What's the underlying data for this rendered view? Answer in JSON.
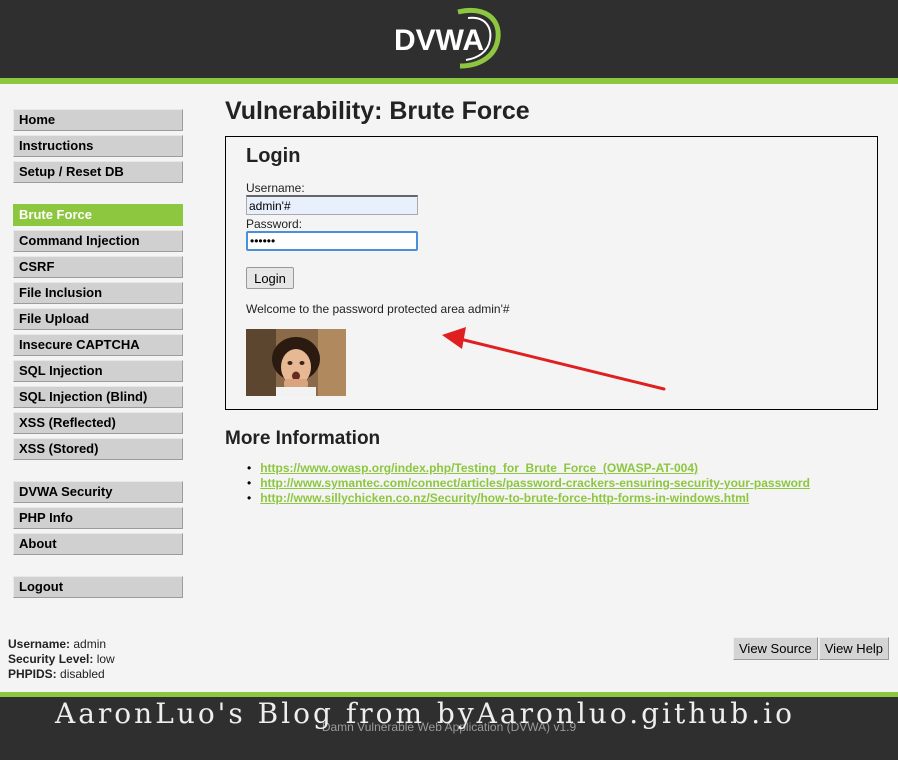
{
  "header": {
    "logo_text": "DVWA"
  },
  "sidebar": {
    "group1": [
      {
        "label": "Home"
      },
      {
        "label": "Instructions"
      },
      {
        "label": "Setup / Reset DB"
      }
    ],
    "group2": [
      {
        "label": "Brute Force",
        "active": true
      },
      {
        "label": "Command Injection"
      },
      {
        "label": "CSRF"
      },
      {
        "label": "File Inclusion"
      },
      {
        "label": "File Upload"
      },
      {
        "label": "Insecure CAPTCHA"
      },
      {
        "label": "SQL Injection"
      },
      {
        "label": "SQL Injection (Blind)"
      },
      {
        "label": "XSS (Reflected)"
      },
      {
        "label": "XSS (Stored)"
      }
    ],
    "group3": [
      {
        "label": "DVWA Security"
      },
      {
        "label": "PHP Info"
      },
      {
        "label": "About"
      }
    ],
    "group4": [
      {
        "label": "Logout"
      }
    ]
  },
  "main": {
    "title": "Vulnerability: Brute Force",
    "login": {
      "title": "Login",
      "username_label": "Username:",
      "username_value": "admin'#",
      "password_label": "Password:",
      "password_value": "••••••",
      "button_label": "Login",
      "welcome": "Welcome to the password protected area admin'#"
    },
    "more_info": {
      "title": "More Information",
      "links": [
        "https://www.owasp.org/index.php/Testing_for_Brute_Force_(OWASP-AT-004)",
        "http://www.symantec.com/connect/articles/password-crackers-ensuring-security-your-password",
        "http://www.sillychicken.co.nz/Security/how-to-brute-force-http-forms-in-windows.html"
      ]
    }
  },
  "status": {
    "username_label": "Username:",
    "username_value": "admin",
    "security_label": "Security Level:",
    "security_value": "low",
    "phpids_label": "PHPIDS:",
    "phpids_value": "disabled"
  },
  "view_buttons": {
    "source": "View Source",
    "help": "View Help"
  },
  "footer": {
    "text": "Damn Vulnerable Web Application (DVWA) v1.9",
    "watermark": "AaronLuo's Blog from byAaronluo.github.io"
  },
  "colors": {
    "accent": "#8dc63f",
    "header_bg": "#2f2f2f",
    "arrow": "#e02020"
  }
}
